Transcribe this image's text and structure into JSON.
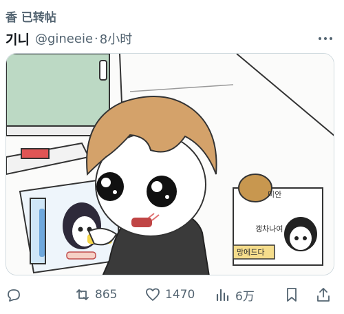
{
  "repost": {
    "label": "香 已转帖"
  },
  "tweet": {
    "author_name": "기니",
    "handle": "@gineeie",
    "separator": "·",
    "time": "8小时"
  },
  "media": {
    "panel_texts": [
      "미안",
      "갱차나여",
      "망에드다"
    ]
  },
  "actions": {
    "retweets": "865",
    "likes": "1470",
    "views": "6万"
  },
  "icons": [
    "reply-icon",
    "retweet-icon",
    "heart-icon",
    "views-icon",
    "bookmark-icon",
    "share-icon",
    "more-icon"
  ],
  "colors": {
    "muted": "#536471",
    "text": "#0f1419",
    "border": "#cfd9de"
  }
}
